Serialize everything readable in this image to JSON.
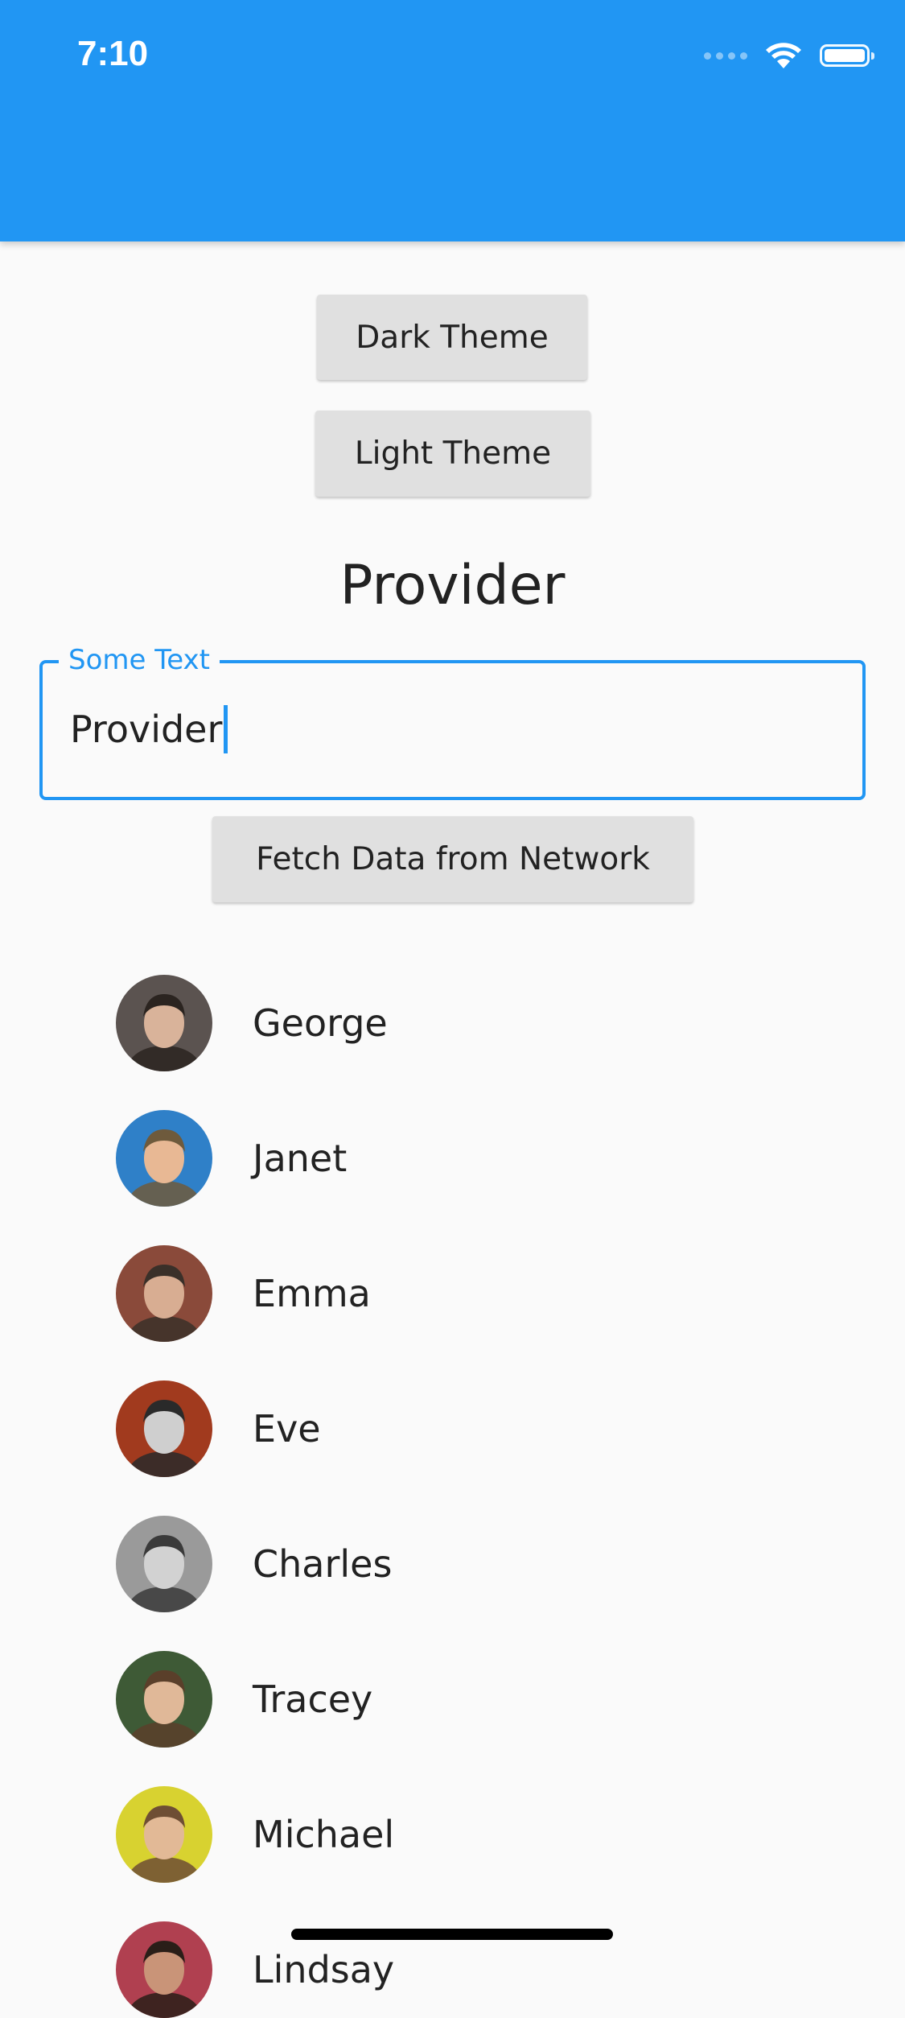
{
  "status_bar": {
    "time": "7:10"
  },
  "buttons": {
    "dark_theme": "Dark Theme",
    "light_theme": "Light Theme",
    "fetch_data": "Fetch Data from Network"
  },
  "heading": "Provider",
  "text_field": {
    "label": "Some Text",
    "value": "Provider"
  },
  "users": [
    {
      "name": "George",
      "avatar_bg": "#5b5350",
      "skin": "#d9b39a",
      "hair": "#2b2420"
    },
    {
      "name": "Janet",
      "avatar_bg": "#2f80c8",
      "skin": "#e8b894",
      "hair": "#6e5a3c"
    },
    {
      "name": "Emma",
      "avatar_bg": "#8a4a3a",
      "skin": "#d8ad92",
      "hair": "#3a3029"
    },
    {
      "name": "Eve",
      "avatar_bg": "#a13a1e",
      "skin": "#cfcfcf",
      "hair": "#2a2a2a"
    },
    {
      "name": "Charles",
      "avatar_bg": "#9a9a9a",
      "skin": "#d2d2d2",
      "hair": "#3a3a3a"
    },
    {
      "name": "Tracey",
      "avatar_bg": "#3e5a36",
      "skin": "#e0b898",
      "hair": "#5a3f2a"
    },
    {
      "name": "Michael",
      "avatar_bg": "#d8d230",
      "skin": "#e2b996",
      "hair": "#6e4e34"
    },
    {
      "name": "Lindsay",
      "avatar_bg": "#b04050",
      "skin": "#c99478",
      "hair": "#2a1e18"
    }
  ],
  "colors": {
    "app_bar": "#2196f3",
    "accent": "#2196f3",
    "background": "#fafafa",
    "button": "#e0e0e0"
  },
  "icons": {
    "wifi": "wifi-icon",
    "battery": "battery-icon",
    "signal": "signal-icon"
  }
}
